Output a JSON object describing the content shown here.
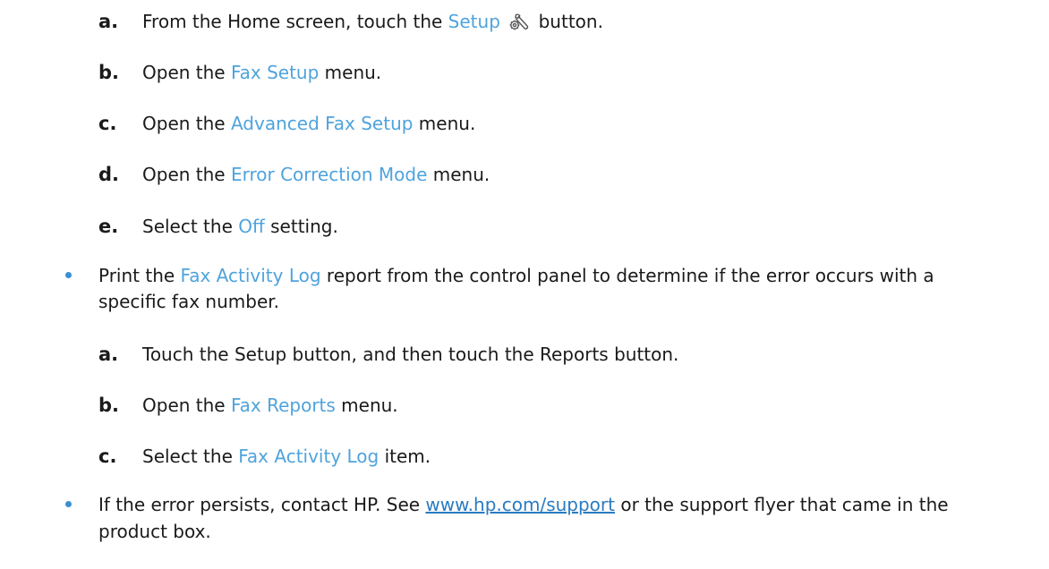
{
  "steps_top": [
    {
      "letter": "a.",
      "pre": "From the Home screen, touch the ",
      "link": "Setup",
      "post": " button.",
      "icon": "setup-wrench-gear-icon"
    },
    {
      "letter": "b.",
      "pre": "Open the ",
      "link": "Fax Setup",
      "post": " menu."
    },
    {
      "letter": "c.",
      "pre": "Open the ",
      "link": "Advanced Fax Setup",
      "post": " menu."
    },
    {
      "letter": "d.",
      "pre": "Open the ",
      "link": "Error Correction Mode",
      "post": " menu."
    },
    {
      "letter": "e.",
      "pre": "Select the ",
      "link": "Off",
      "post": " setting."
    }
  ],
  "bullet1": {
    "pre": "Print the ",
    "link": "Fax Activity Log",
    "post": " report from the control panel to determine if the error occurs with a",
    "line2": "specific fax number."
  },
  "steps_bullet1": [
    {
      "letter": "a.",
      "text": "Touch the Setup button, and then touch the Reports button."
    },
    {
      "letter": "b.",
      "pre": "Open the ",
      "link": "Fax Reports",
      "post": " menu."
    },
    {
      "letter": "c.",
      "pre": "Select the ",
      "link": "Fax Activity Log",
      "post": " item."
    }
  ],
  "bullet2": {
    "pre": "If the error persists, contact HP. See ",
    "url": "www.hp.com/support",
    "post": " or the support flyer that came in the",
    "line2": "product box."
  },
  "colors": {
    "link": "#4fa3dc",
    "url": "#2a7bc0",
    "bullet": "#3a8fd0"
  }
}
